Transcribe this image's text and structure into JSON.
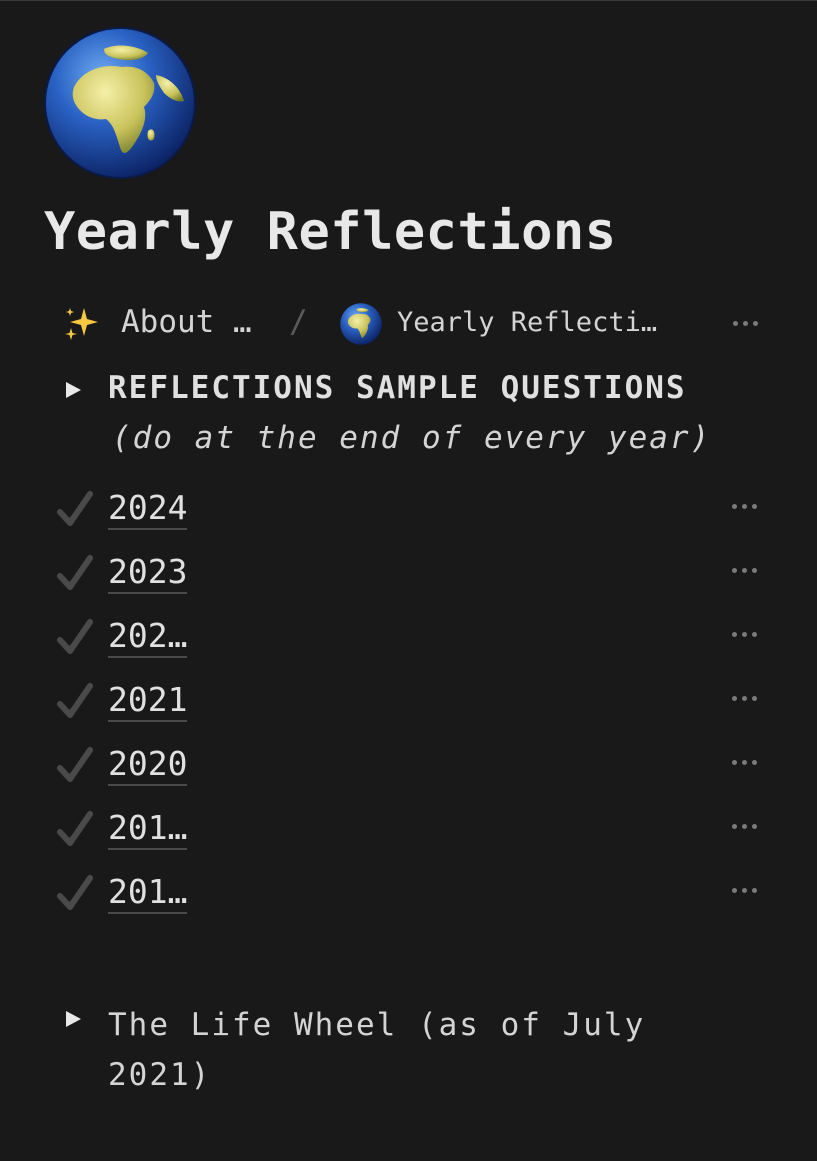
{
  "page": {
    "icon": "globe-europe-africa-icon",
    "title": "Yearly Reflections"
  },
  "breadcrumb": {
    "parent_icon": "sparkles-icon",
    "parent_label": "About …",
    "separator": "/",
    "current_icon": "globe-europe-africa-icon",
    "current_label": "Yearly Reflecti…",
    "more_icon": "more-horizontal-icon"
  },
  "reflections_toggle": {
    "icon": "triangle-right-icon",
    "heading": "REFLECTIONS SAMPLE QUESTIONS",
    "subtitle": "(do at the end of every year)"
  },
  "years": [
    {
      "label": "2024",
      "icon": "checkmark-icon",
      "more_icon": "more-horizontal-icon"
    },
    {
      "label": "2023",
      "icon": "checkmark-icon",
      "more_icon": "more-horizontal-icon"
    },
    {
      "label": "202…",
      "icon": "checkmark-icon",
      "more_icon": "more-horizontal-icon"
    },
    {
      "label": "2021",
      "icon": "checkmark-icon",
      "more_icon": "more-horizontal-icon"
    },
    {
      "label": "2020",
      "icon": "checkmark-icon",
      "more_icon": "more-horizontal-icon"
    },
    {
      "label": "201…",
      "icon": "checkmark-icon",
      "more_icon": "more-horizontal-icon"
    },
    {
      "label": "201…",
      "icon": "checkmark-icon",
      "more_icon": "more-horizontal-icon"
    }
  ],
  "life_wheel_toggle": {
    "icon": "triangle-right-icon",
    "label": "The Life Wheel (as of July 2021)"
  },
  "colors": {
    "background": "#191919",
    "text": "#d4d4d4",
    "muted": "#7a7a7a",
    "check": "#4a4a4a"
  }
}
